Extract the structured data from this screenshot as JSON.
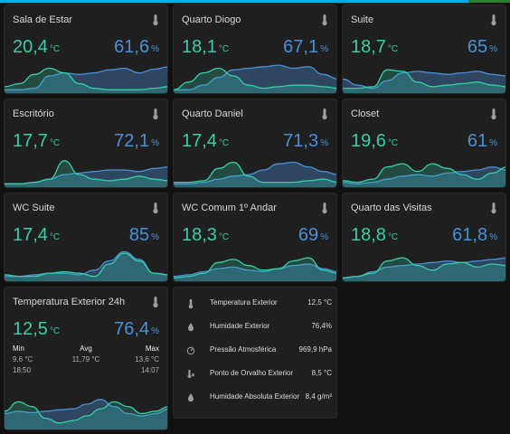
{
  "colors": {
    "temperature": "#35d0a8",
    "humidity": "#4a90d9",
    "card_bg": "#1f1f1f",
    "page_bg": "#111111"
  },
  "sensor_cards": [
    {
      "name": "Sala de Estar",
      "temperature": "20,4",
      "temp_unit": "°C",
      "humidity": "61,6",
      "hum_unit": "%",
      "icon": "thermometer-icon",
      "temp_history": [
        0.15,
        0.25,
        0.55,
        0.75,
        0.6,
        0.25,
        0.1,
        0.05,
        0.05,
        0.05,
        0.1,
        0.15
      ],
      "hum_history": [
        0.05,
        0.05,
        0.1,
        0.5,
        0.6,
        0.55,
        0.6,
        0.7,
        0.75,
        0.6,
        0.72,
        0.8
      ]
    },
    {
      "name": "Quarto Diogo",
      "temperature": "18,1",
      "temp_unit": "°C",
      "humidity": "67,1",
      "hum_unit": "%",
      "icon": "thermometer-icon",
      "temp_history": [
        0.05,
        0.3,
        0.6,
        0.75,
        0.5,
        0.2,
        0.1,
        0.15,
        0.2,
        0.2,
        0.15,
        0.1
      ],
      "hum_history": [
        0.05,
        0.05,
        0.2,
        0.45,
        0.7,
        0.75,
        0.8,
        0.85,
        0.75,
        0.8,
        0.55,
        0.4
      ]
    },
    {
      "name": "Suite",
      "temperature": "18,7",
      "temp_unit": "°C",
      "humidity": "65",
      "hum_unit": "%",
      "icon": "thermometer-icon",
      "temp_history": [
        0.1,
        0.1,
        0.15,
        0.7,
        0.65,
        0.3,
        0.15,
        0.2,
        0.25,
        0.3,
        0.2,
        0.15
      ],
      "hum_history": [
        0.4,
        0.2,
        0.1,
        0.35,
        0.6,
        0.65,
        0.6,
        0.55,
        0.6,
        0.65,
        0.55,
        0.5
      ]
    },
    {
      "name": "Escritório",
      "temperature": "17,7",
      "temp_unit": "°C",
      "humidity": "72,1",
      "hum_unit": "%",
      "icon": "thermometer-icon",
      "temp_history": [
        0.05,
        0.05,
        0.1,
        0.2,
        0.8,
        0.35,
        0.2,
        0.15,
        0.2,
        0.3,
        0.2,
        0.15
      ],
      "hum_history": [
        0.05,
        0.05,
        0.1,
        0.2,
        0.35,
        0.4,
        0.45,
        0.5,
        0.5,
        0.45,
        0.55,
        0.6
      ]
    },
    {
      "name": "Quarto Daniel",
      "temperature": "17,4",
      "temp_unit": "°C",
      "humidity": "71,3",
      "hum_unit": "%",
      "icon": "thermometer-icon",
      "temp_history": [
        0.1,
        0.1,
        0.15,
        0.55,
        0.75,
        0.3,
        0.1,
        0.1,
        0.1,
        0.15,
        0.2,
        0.1
      ],
      "hum_history": [
        0.05,
        0.05,
        0.1,
        0.2,
        0.3,
        0.35,
        0.5,
        0.7,
        0.75,
        0.6,
        0.45,
        0.35
      ]
    },
    {
      "name": "Closet",
      "temperature": "19,6",
      "temp_unit": "°C",
      "humidity": "61",
      "hum_unit": "%",
      "icon": "thermometer-icon",
      "temp_history": [
        0.15,
        0.1,
        0.2,
        0.6,
        0.7,
        0.45,
        0.7,
        0.55,
        0.35,
        0.2,
        0.4,
        0.6
      ],
      "hum_history": [
        0.1,
        0.05,
        0.1,
        0.2,
        0.3,
        0.35,
        0.3,
        0.4,
        0.45,
        0.5,
        0.6,
        0.5
      ]
    },
    {
      "name": "WC Suite",
      "temperature": "17,4",
      "temp_unit": "°C",
      "humidity": "85",
      "hum_unit": "%",
      "icon": "thermometer-icon",
      "temp_history": [
        0.15,
        0.1,
        0.1,
        0.2,
        0.25,
        0.2,
        0.1,
        0.5,
        0.85,
        0.6,
        0.2,
        0.15
      ],
      "hum_history": [
        0.1,
        0.1,
        0.15,
        0.2,
        0.2,
        0.15,
        0.3,
        0.6,
        0.9,
        0.65,
        0.2,
        0.15
      ]
    },
    {
      "name": "WC Comum 1º Andar",
      "temperature": "18,3",
      "temp_unit": "°C",
      "humidity": "69",
      "hum_unit": "%",
      "icon": "thermometer-icon",
      "temp_history": [
        0.05,
        0.1,
        0.2,
        0.55,
        0.65,
        0.45,
        0.3,
        0.35,
        0.6,
        0.7,
        0.3,
        0.2
      ],
      "hum_history": [
        0.1,
        0.15,
        0.25,
        0.35,
        0.4,
        0.3,
        0.25,
        0.35,
        0.45,
        0.5,
        0.35,
        0.25
      ]
    },
    {
      "name": "Quarto das Visitas",
      "temperature": "18,8",
      "temp_unit": "°C",
      "humidity": "61,8",
      "hum_unit": "%",
      "icon": "thermometer-icon",
      "temp_history": [
        0.05,
        0.1,
        0.2,
        0.6,
        0.7,
        0.45,
        0.3,
        0.5,
        0.55,
        0.4,
        0.5,
        0.45
      ],
      "hum_history": [
        0.05,
        0.1,
        0.25,
        0.4,
        0.45,
        0.5,
        0.55,
        0.6,
        0.55,
        0.6,
        0.65,
        0.7
      ]
    }
  ],
  "exterior_card": {
    "name": "Temperatura Exterior 24h",
    "temperature": "12,5",
    "temp_unit": "°C",
    "humidity": "76,4",
    "hum_unit": "%",
    "icon": "thermometer-icon",
    "min_label": "Min",
    "min_value": "9,6 °C",
    "min_time": "18:50",
    "avg_label": "Avg",
    "avg_value": "11,79 °C",
    "max_label": "Max",
    "max_value": "13,6 °C",
    "max_time": "14:07",
    "temp_history": [
      0.35,
      0.55,
      0.45,
      0.2,
      0.1,
      0.15,
      0.25,
      0.4,
      0.55,
      0.45,
      0.3,
      0.35,
      0.45
    ],
    "hum_history": [
      0.3,
      0.35,
      0.32,
      0.35,
      0.38,
      0.4,
      0.5,
      0.6,
      0.45,
      0.3,
      0.25,
      0.3,
      0.4
    ]
  },
  "entities_card": {
    "rows": [
      {
        "icon": "thermometer-icon",
        "label": "Temperatura Exterior",
        "value": "12,5 °C"
      },
      {
        "icon": "water-drop-icon",
        "label": "Humidade Exterior",
        "value": "76,4%"
      },
      {
        "icon": "gauge-icon",
        "label": "Pressão Atmosférica",
        "value": "969,9 hPa"
      },
      {
        "icon": "thermometer-water-icon",
        "label": "Ponto de Orvalho Exterior",
        "value": "8,5 °C"
      },
      {
        "icon": "water-drop-icon",
        "label": "Humidade Absoluta Exterior",
        "value": "8,4 g/m³"
      }
    ]
  }
}
